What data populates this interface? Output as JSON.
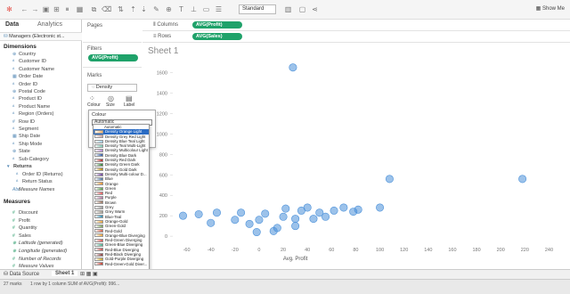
{
  "toolbar": {
    "icons": [
      "tableau-logo-icon",
      "undo-icon",
      "redo-icon",
      "save-icon",
      "new-datasource-icon",
      "pause-icon",
      "new-sheet-icon",
      "duplicate-icon",
      "clear-icon",
      "swap-icon",
      "sort-asc-icon",
      "sort-desc-icon",
      "highlight-icon",
      "group-icon",
      "label-icon",
      "fix-axes-icon",
      "present-icon",
      "tooltip-icon",
      "share-icon"
    ],
    "fit": "Standard",
    "show_me": "Show Me"
  },
  "data_pane": {
    "tab_data": "Data",
    "tab_analytics": "Analytics",
    "datasource": "Managers (Electronic st...",
    "dimensions_title": "Dimensions",
    "dimensions": [
      "Country",
      "Customer ID",
      "Customer Name",
      "Order Date",
      "Order ID",
      "Postal Code",
      "Product ID",
      "Product Name",
      "Region (Orders)",
      "Row ID",
      "Segment",
      "Ship Date",
      "Ship Mode",
      "State",
      "Sub-Category"
    ],
    "returns_group": "Returns",
    "returns_fields": [
      "Order ID (Returns)",
      "Return Status"
    ],
    "measure_names": "Measure Names",
    "measures_title": "Measures",
    "measures": [
      "Discount",
      "Profit",
      "Quantity",
      "Sales",
      "Latitude (generated)",
      "Longitude (generated)",
      "Number of Records",
      "Measure Values"
    ]
  },
  "cards": {
    "pages": "Pages",
    "filters": "Filters",
    "filter_pill": "AVG(Profit)",
    "marks": "Marks",
    "mark_type": "Density",
    "mark_buttons": [
      "Colour",
      "Size",
      "Label"
    ],
    "color_popup_title": "Colour",
    "color_popup_select": "Automatic"
  },
  "shelves": {
    "columns_label": "Columns",
    "columns_pill": "AVG(Profit)",
    "rows_label": "Rows",
    "rows_pill": "AVG(Sales)"
  },
  "palettes": [
    "Automatic",
    "Density Orange Light",
    "Density Grey Red Light",
    "Density Blue Teal Light",
    "Density Teal Multi-Light",
    "Density Multicolour Light",
    "Density Blue Dark",
    "Density Red Dark",
    "Density Green Dark",
    "Density Gold Dark",
    "Density Multi-colour D...",
    "Blue",
    "Orange",
    "Green",
    "Red",
    "Purple",
    "Brown",
    "Grey",
    "Grey Warm",
    "Blue-Teal",
    "Orange-Gold",
    "Green-Gold",
    "Red-Gold",
    "Orange-Blue Diverging",
    "Red-Green Diverging",
    "Green-Blue Diverging",
    "Red-Blue Diverging",
    "Red-Black Diverging",
    "Gold-Purple Diverging",
    "Red-Green-Gold Diver..."
  ],
  "palette_colors": [
    "#ffffff",
    "#f7b267",
    "#c9a0a0",
    "#9ecae1",
    "#7bc9b1",
    "#b084cc",
    "#2e5aa8",
    "#b22222",
    "#2e7d32",
    "#b8860b",
    "#6a3d9a",
    "#4e79a7",
    "#f28e2b",
    "#59a14f",
    "#e15759",
    "#b07aa1",
    "#9c755f",
    "#9d9d9d",
    "#a89f91",
    "#2a8ab0",
    "#e8a33b",
    "#7aa35a",
    "#d35f4a",
    "#e8a33b",
    "#d9534f",
    "#4caf90",
    "#c94c4c",
    "#8b3a3a",
    "#c9a227",
    "#c0392b"
  ],
  "view": {
    "sheet_title": "Sheet 1"
  },
  "chart_data": {
    "type": "scatter",
    "xlabel": "Avg. Profit",
    "ylabel": "Avg. Sales",
    "x_ticks": [
      "-60",
      "-40",
      "-20",
      "0",
      "20",
      "40",
      "60",
      "80",
      "100",
      "120",
      "140",
      "160",
      "180",
      "200",
      "220",
      "240"
    ],
    "y_ticks": [
      "1600",
      "1400",
      "1200",
      "1000",
      "800",
      "600",
      "400",
      "200",
      "0"
    ],
    "xlim": [
      -70,
      250
    ],
    "ylim": [
      -60,
      1700
    ],
    "points": [
      [
        28,
        1650
      ],
      [
        -63,
        200
      ],
      [
        -50,
        215
      ],
      [
        -35,
        230
      ],
      [
        -20,
        160
      ],
      [
        -15,
        230
      ],
      [
        -8,
        120
      ],
      [
        -2,
        40
      ],
      [
        5,
        220
      ],
      [
        12,
        50
      ],
      [
        15,
        80
      ],
      [
        20,
        190
      ],
      [
        22,
        270
      ],
      [
        30,
        170
      ],
      [
        35,
        250
      ],
      [
        40,
        280
      ],
      [
        45,
        170
      ],
      [
        50,
        230
      ],
      [
        55,
        190
      ],
      [
        62,
        250
      ],
      [
        70,
        280
      ],
      [
        78,
        240
      ],
      [
        82,
        260
      ],
      [
        100,
        280
      ],
      [
        108,
        560
      ],
      [
        218,
        560
      ],
      [
        30,
        100
      ],
      [
        0,
        160
      ],
      [
        -40,
        130
      ]
    ],
    "mark_color": "#4a90d9"
  },
  "tabs": {
    "data_source": "Data Source",
    "sheet": "Sheet 1"
  },
  "status": {
    "marks": "27 marks",
    "rows_cols": "1 row by 1 column",
    "sum": "SUM of AVG(Profit): 996..."
  }
}
